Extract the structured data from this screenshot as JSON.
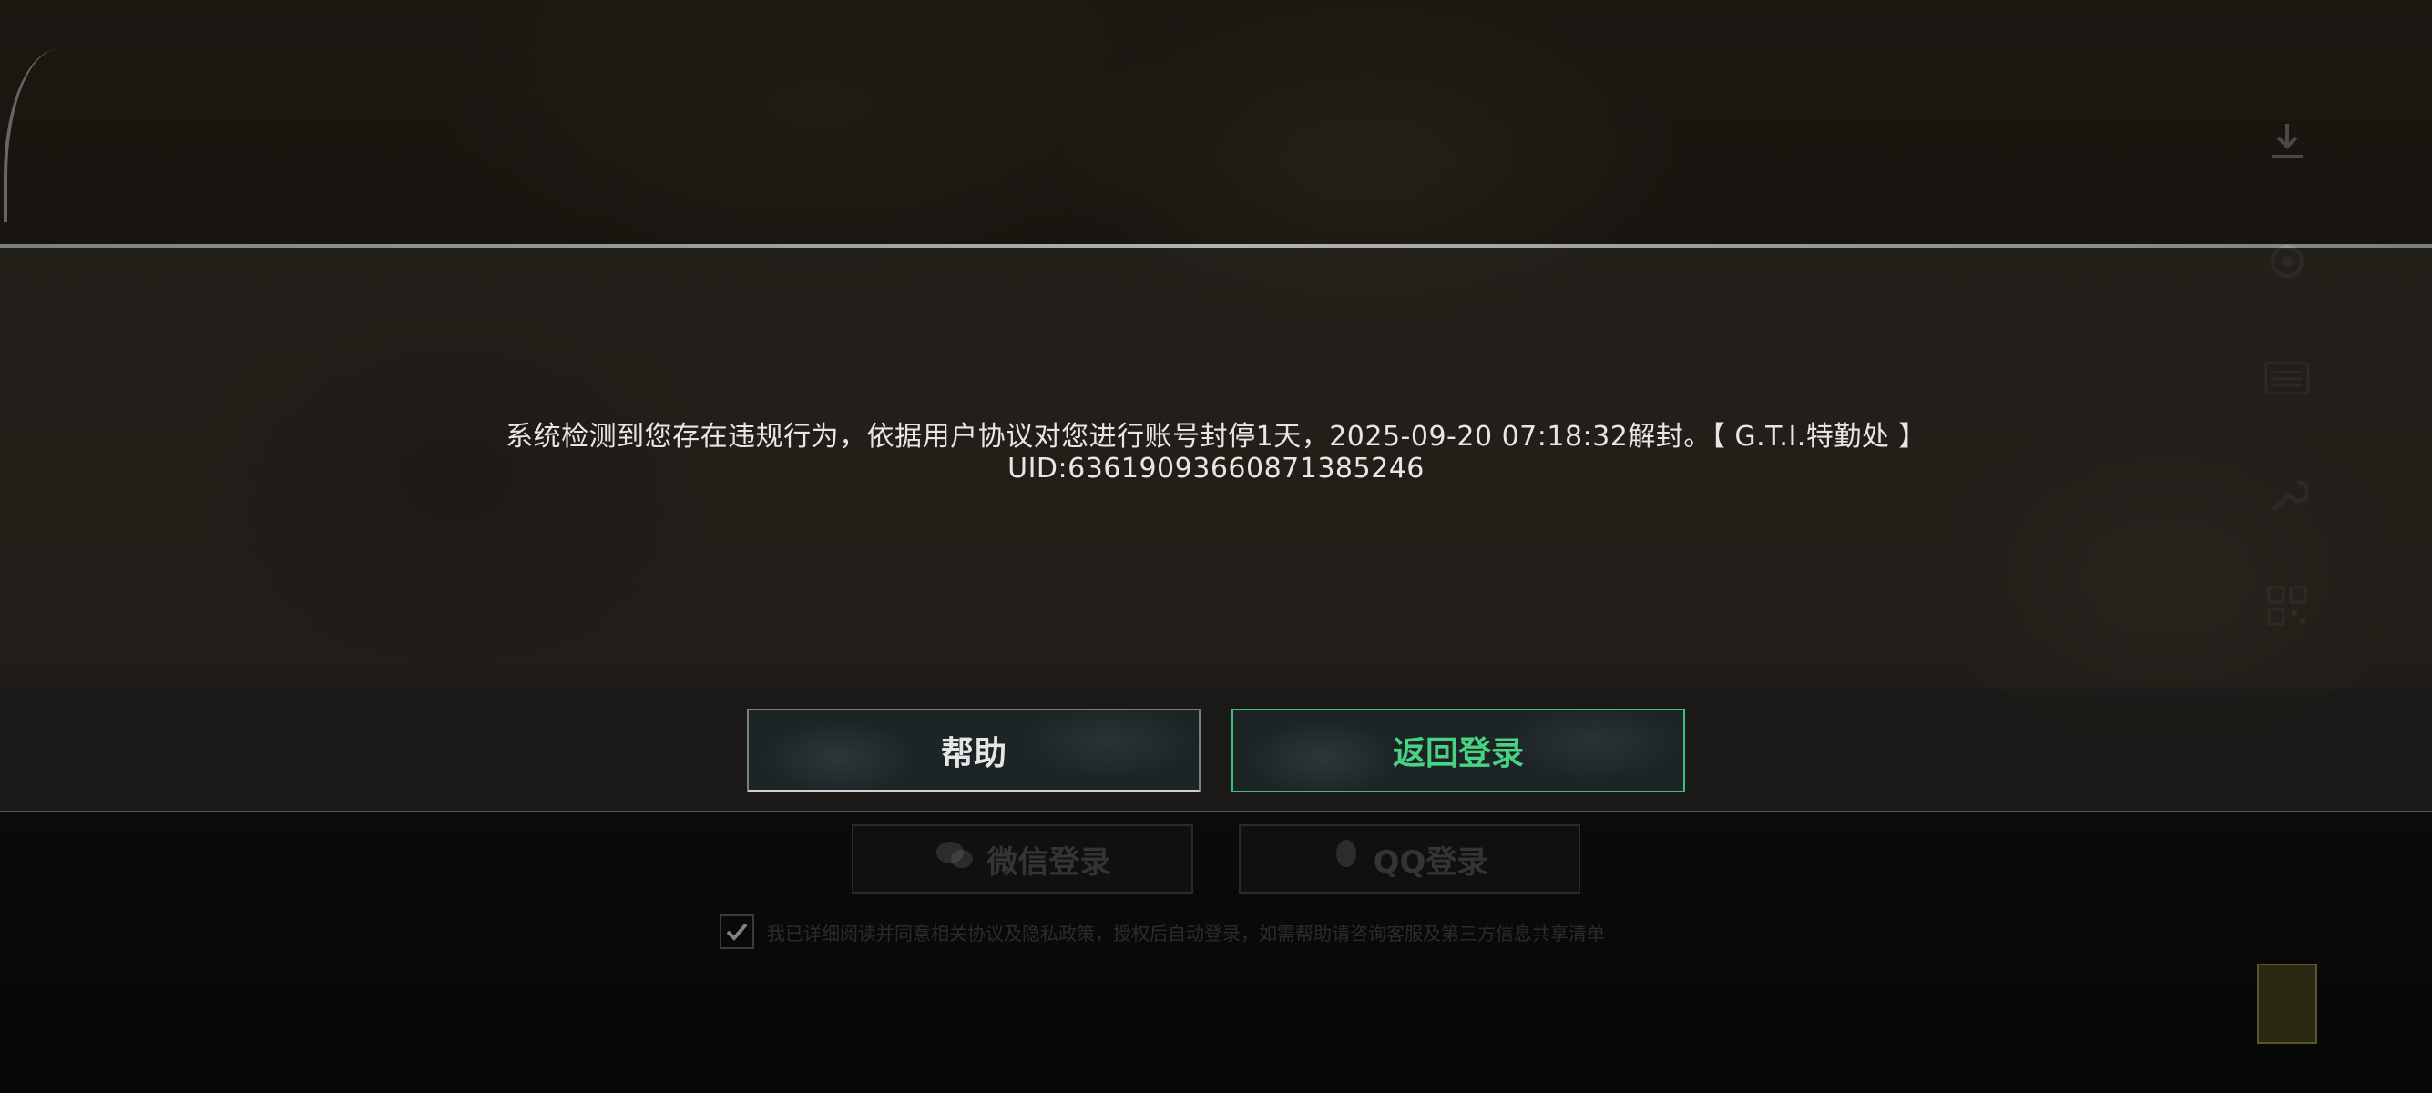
{
  "dialog": {
    "message_line1": "系统检测到您存在违规行为，依据用户协议对您进行账号封停1天，2025-09-20 07:18:32解封。【 G.T.I.特勤处 】",
    "message_line2": "UID:636190936608713852​46"
  },
  "buttons": {
    "help_label": "帮助",
    "return_login_label": "返回登录"
  },
  "login": {
    "wechat_label": "微信登录",
    "qq_label": "QQ登录",
    "agreement_text": "我已详细阅读并同意相关协议及隐私政策，授权后自动登录，如需帮助请咨询客服及第三方信息共享清单",
    "agreement_checked": true
  },
  "side_icons": [
    "download-icon",
    "target-icon",
    "menu-icon",
    "wrench-icon",
    "qr-code-icon"
  ],
  "colors": {
    "accent_green": "#49d284",
    "button_border_green": "#3fbf74",
    "text_light": "#e8e6e2"
  }
}
